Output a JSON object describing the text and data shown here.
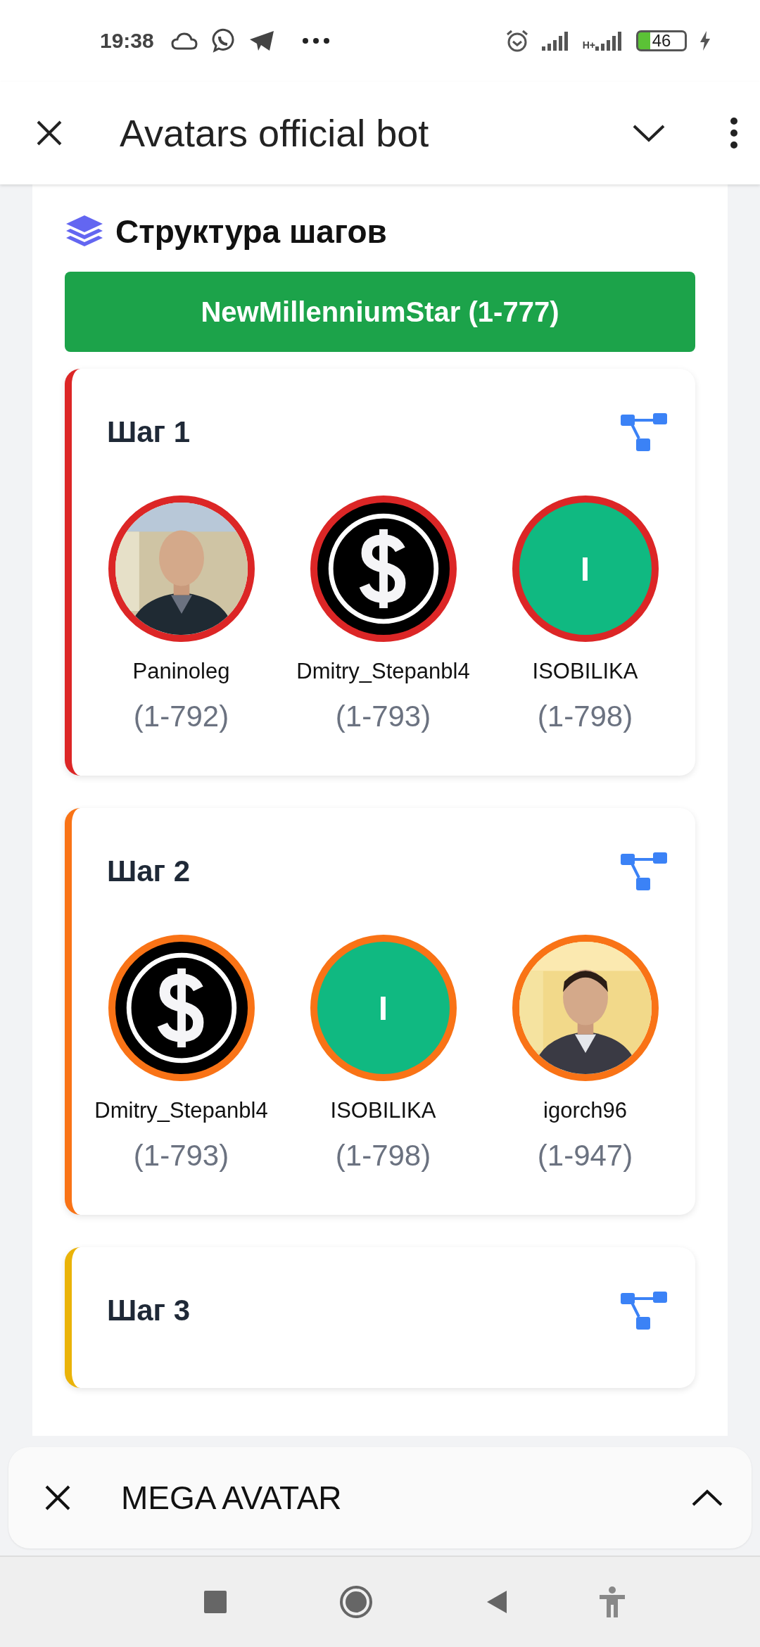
{
  "status_bar": {
    "time": "19:38",
    "network_label": "H+",
    "battery": "46"
  },
  "header": {
    "title": "Avatars official bot"
  },
  "panel": {
    "title": "Структура шагов",
    "banner": "NewMillenniumStar (1-777)",
    "steps": [
      {
        "title": "Шаг 1",
        "color": "#dc2626",
        "avatars": [
          {
            "kind": "picture",
            "name": "Paninoleg",
            "code": "(1-792)"
          },
          {
            "kind": "dollar",
            "name": "Dmitry_Stepanbl4",
            "code": "(1-793)"
          },
          {
            "kind": "letter",
            "letter": "I",
            "name": "ISOBILIKA",
            "code": "(1-798)"
          }
        ]
      },
      {
        "title": "Шаг 2",
        "color": "#f97316",
        "avatars": [
          {
            "kind": "dollar",
            "name": "Dmitry_Stepanbl4",
            "code": "(1-793)"
          },
          {
            "kind": "letter",
            "letter": "I",
            "name": "ISOBILIKA",
            "code": "(1-798)"
          },
          {
            "kind": "picture",
            "name": "igorch96",
            "code": "(1-947)"
          }
        ]
      },
      {
        "title": "Шаг 3",
        "color": "#eab308"
      }
    ]
  },
  "mini_bar": {
    "title": "MEGA AVATAR"
  }
}
